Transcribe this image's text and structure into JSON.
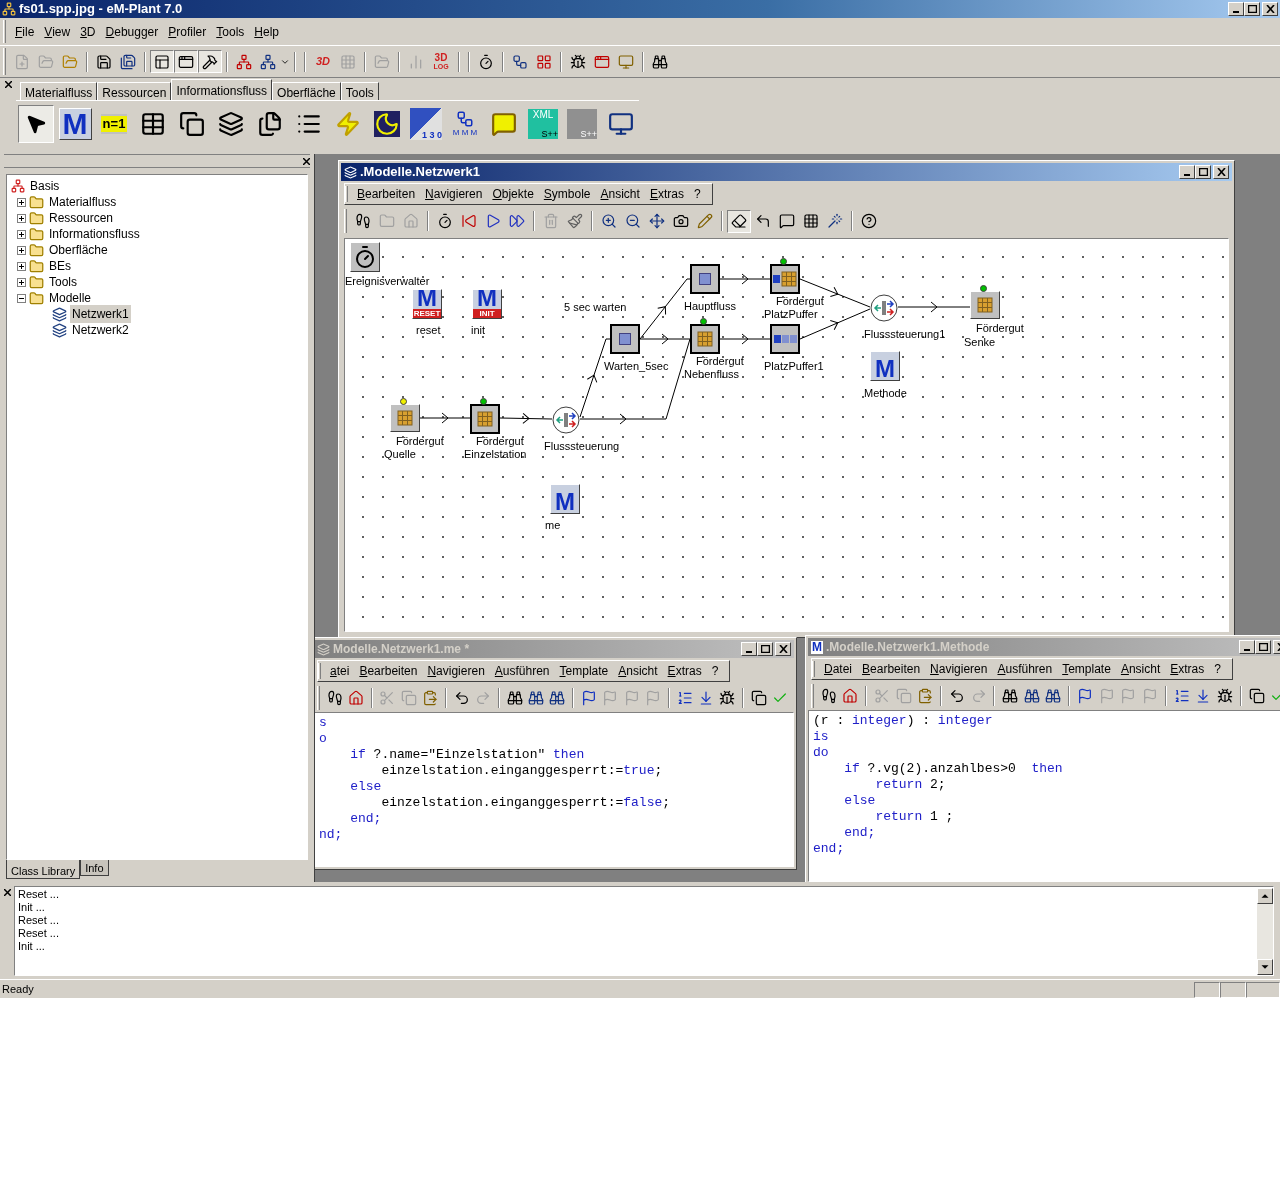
{
  "window": {
    "title": "fs01.spp.jpg - eM-Plant 7.0"
  },
  "menu_bar": [
    "File",
    "View",
    "3D",
    "Debugger",
    "Profiler",
    "Tools",
    "Help"
  ],
  "toolbar": {
    "label_3d": "3D",
    "log_icon": {
      "top": "3D",
      "bottom": "LOG"
    }
  },
  "class_tabs": [
    {
      "label": "Materialfluss",
      "selected": false
    },
    {
      "label": "Ressourcen",
      "selected": false
    },
    {
      "label": "Informationsfluss",
      "selected": true
    },
    {
      "label": "Oberfläche",
      "selected": false
    },
    {
      "label": "Tools",
      "selected": false
    }
  ],
  "palette": [
    {
      "kind": "pointer",
      "selected": true
    },
    {
      "kind": "method",
      "glyph": "M",
      "selected": false
    },
    {
      "kind": "variable",
      "glyph": "n=1",
      "selected": false
    },
    {
      "kind": "table",
      "selected": false
    },
    {
      "kind": "stack",
      "selected": false
    },
    {
      "kind": "layers",
      "selected": false
    },
    {
      "kind": "sheets",
      "selected": false
    },
    {
      "kind": "list",
      "selected": false
    },
    {
      "kind": "generator",
      "selected": false
    },
    {
      "kind": "shift",
      "selected": false
    },
    {
      "kind": "experiment",
      "glyph": "1 3 0",
      "selected": false
    },
    {
      "kind": "distributor",
      "glyph": "M M M",
      "selected": false
    },
    {
      "kind": "comment",
      "selected": false
    },
    {
      "kind": "xml",
      "glyph": "XML",
      "sub": "S++",
      "selected": false
    },
    {
      "kind": "socket",
      "sub": "S++",
      "selected": false
    },
    {
      "kind": "display",
      "selected": false
    }
  ],
  "class_library": {
    "tree": [
      {
        "label": "Basis",
        "kind": "root",
        "expanded": true,
        "selected": false,
        "children": [
          {
            "label": "Materialfluss",
            "kind": "folder",
            "expanded": false,
            "selected": false
          },
          {
            "label": "Ressourcen",
            "kind": "folder",
            "expanded": false,
            "selected": false
          },
          {
            "label": "Informationsfluss",
            "kind": "folder",
            "expanded": false,
            "selected": false
          },
          {
            "label": "Oberfläche",
            "kind": "folder",
            "expanded": false,
            "selected": false
          },
          {
            "label": "BEs",
            "kind": "folder",
            "expanded": false,
            "selected": false
          },
          {
            "label": "Tools",
            "kind": "folder",
            "expanded": false,
            "selected": false
          },
          {
            "label": "Modelle",
            "kind": "folder",
            "expanded": true,
            "selected": false,
            "children": [
              {
                "label": "Netzwerk1",
                "kind": "network",
                "selected": true
              },
              {
                "label": "Netzwerk2",
                "kind": "network",
                "selected": false
              }
            ]
          }
        ]
      }
    ],
    "tabs": [
      {
        "label": "Class Library",
        "selected": true
      },
      {
        "label": "Info",
        "selected": false
      }
    ]
  },
  "network_window": {
    "title": ".Modelle.Netzwerk1",
    "active": true,
    "menu": [
      "Bearbeiten",
      "Navigieren",
      "Objekte",
      "Symbole",
      "Ansicht",
      "Extras",
      "?"
    ],
    "note": "5 sec warten",
    "nodes": [
      {
        "kind": "event_controller",
        "name": "Ereignisverwalter"
      },
      {
        "kind": "method",
        "glyph": "M",
        "band": "RESET",
        "name": "reset"
      },
      {
        "kind": "method",
        "glyph": "M",
        "band": "INIT",
        "name": "init"
      },
      {
        "kind": "single_proc",
        "name": "Hauptfluss"
      },
      {
        "kind": "buffer",
        "content": "Fördergut",
        "color": "#00c000",
        "name": "PlatzPuffer"
      },
      {
        "kind": "single_proc",
        "name": "Warten_5sec"
      },
      {
        "kind": "single_proc",
        "content": "Fördergut",
        "color": "#00c000",
        "name": "Nebenfluss"
      },
      {
        "kind": "buffer",
        "name": "PlatzPuffer1"
      },
      {
        "kind": "flow_control",
        "name": "Flusssteuerung1"
      },
      {
        "kind": "drain",
        "content": "Fördergut",
        "color": "#00c000",
        "name": "Senke"
      },
      {
        "kind": "method",
        "glyph": "M",
        "name": "Methode"
      },
      {
        "kind": "source",
        "content": "Fördergut",
        "color": "#f0f000",
        "name": "Quelle"
      },
      {
        "kind": "single_proc",
        "content": "Fördergut",
        "color": "#00c000",
        "name": "Einzelstation"
      },
      {
        "kind": "flow_control",
        "name": "Flusssteuerung"
      },
      {
        "kind": "method",
        "glyph": "M",
        "name": "me"
      }
    ]
  },
  "editors": [
    {
      "title": "Modelle.Netzwerk1.me *",
      "active": false,
      "menu": [
        "atei",
        "Bearbeiten",
        "Navigieren",
        "Ausführen",
        "Template",
        "Ansicht",
        "Extras",
        "?"
      ],
      "lines": [
        [
          {
            "text": "s",
            "kind": "keyword"
          }
        ],
        [
          {
            "text": "o",
            "kind": "keyword"
          }
        ],
        [
          {
            "text": "    if",
            "kind": "keyword"
          },
          {
            "text": " ?.name=\"Einzelstation\" ",
            "kind": "plain"
          },
          {
            "text": "then",
            "kind": "keyword"
          }
        ],
        [
          {
            "text": "        einzelstation.einganggesperrt:=",
            "kind": "plain"
          },
          {
            "text": "true",
            "kind": "keyword"
          },
          {
            "text": ";",
            "kind": "plain"
          }
        ],
        [
          {
            "text": "    else",
            "kind": "keyword"
          }
        ],
        [
          {
            "text": "        einzelstation.einganggesperrt:=",
            "kind": "plain"
          },
          {
            "text": "false",
            "kind": "keyword"
          },
          {
            "text": ";",
            "kind": "plain"
          }
        ],
        [
          {
            "text": "    end;",
            "kind": "keyword"
          }
        ],
        [
          {
            "text": "nd;",
            "kind": "keyword"
          }
        ]
      ]
    },
    {
      "title": ".Modelle.Netzwerk1.Methode",
      "active": false,
      "glyph": "M",
      "menu": [
        "Datei",
        "Bearbeiten",
        "Navigieren",
        "Ausführen",
        "Template",
        "Ansicht",
        "Extras",
        "?"
      ],
      "lines": [
        [
          {
            "text": "(r : ",
            "kind": "plain"
          },
          {
            "text": "integer",
            "kind": "keyword"
          },
          {
            "text": ") : ",
            "kind": "plain"
          },
          {
            "text": "integer",
            "kind": "keyword"
          }
        ],
        [
          {
            "text": "is",
            "kind": "keyword"
          }
        ],
        [
          {
            "text": "do",
            "kind": "keyword"
          }
        ],
        [
          {
            "text": "    if",
            "kind": "keyword"
          },
          {
            "text": " ?.vg(2).anzahlbes>0  ",
            "kind": "plain"
          },
          {
            "text": "then",
            "kind": "keyword"
          }
        ],
        [
          {
            "text": "        return",
            "kind": "keyword"
          },
          {
            "text": " 2;",
            "kind": "plain"
          }
        ],
        [
          {
            "text": "    else",
            "kind": "keyword"
          }
        ],
        [
          {
            "text": "        return",
            "kind": "keyword"
          },
          {
            "text": " 1 ;",
            "kind": "plain"
          }
        ],
        [
          {
            "text": "    end;",
            "kind": "keyword"
          }
        ],
        [
          {
            "text": "end;",
            "kind": "keyword"
          }
        ]
      ]
    }
  ],
  "log": {
    "lines": [
      "Reset ...",
      "Init ...",
      "Reset ...",
      "Reset ...",
      "Init ..."
    ]
  },
  "status_bar": {
    "text": "Ready"
  }
}
